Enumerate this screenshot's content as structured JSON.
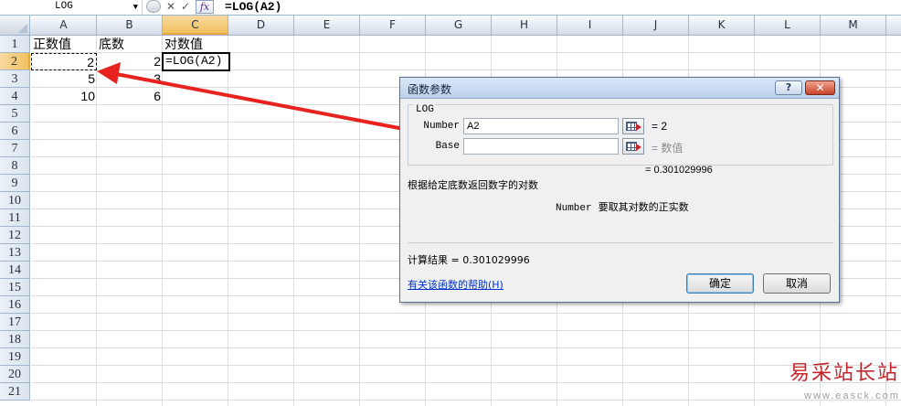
{
  "formula_bar": {
    "name_box": "LOG",
    "formula": "=LOG(A2)",
    "fx_label": "fx",
    "cancel_glyph": "✕",
    "enter_glyph": "✓"
  },
  "columns": [
    "A",
    "B",
    "C",
    "D",
    "E",
    "F",
    "G",
    "H",
    "I",
    "J",
    "K",
    "L",
    "M"
  ],
  "active_column": "C",
  "rows": [
    "1",
    "2",
    "3",
    "4",
    "5",
    "6",
    "7",
    "8",
    "9",
    "10",
    "11",
    "12",
    "13",
    "14",
    "15",
    "16",
    "17",
    "18",
    "19",
    "20",
    "21"
  ],
  "active_row": "2",
  "cells": {
    "A1": "正数值",
    "B1": "底数",
    "C1": "对数值",
    "A2": "2",
    "B2": "2",
    "C2": "=LOG(A2)",
    "A3": "5",
    "B3": "3",
    "A4": "10",
    "B4": "6"
  },
  "dialog": {
    "title": "函数参数",
    "help_button": "?",
    "close_button": "✕",
    "function_name": "LOG",
    "args": [
      {
        "label": "Number",
        "value": "A2",
        "result": "= 2"
      },
      {
        "label": "Base",
        "value": "",
        "result": "= 数值"
      }
    ],
    "result_line": "= 0.301029996",
    "description": "根据给定底数返回数字的对数",
    "arg_desc_name": "Number",
    "arg_desc_text": "要取其对数的正实数",
    "calc_result": "计算结果 = 0.301029996",
    "help_link": "有关该函数的帮助(H)",
    "ok_button": "确定",
    "cancel_button": "取消"
  },
  "watermark": {
    "text": "易采站长站",
    "url": "www.easck.com"
  },
  "colors": {
    "arrow": "#e8231f",
    "active_header": "#f1c15f",
    "link": "#0033cc"
  }
}
